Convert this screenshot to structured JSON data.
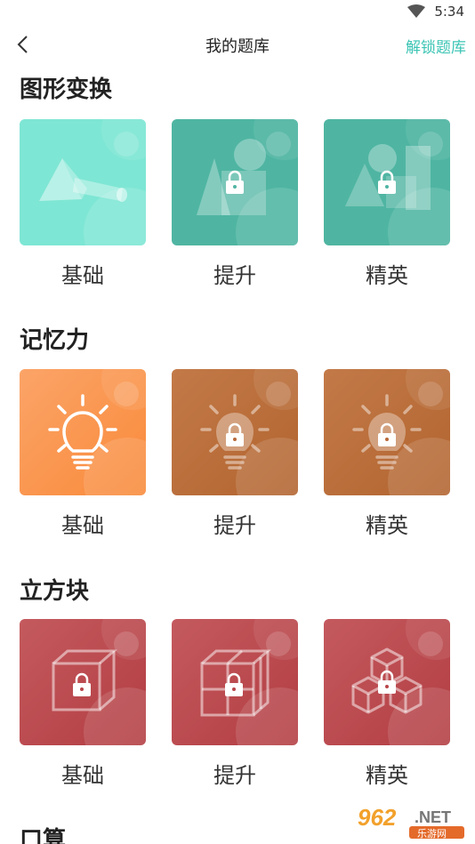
{
  "status": {
    "time": "5:34"
  },
  "nav": {
    "title": "我的题库",
    "action": "解锁题库"
  },
  "sections": [
    {
      "title": "图形变换",
      "items": [
        {
          "label": "基础"
        },
        {
          "label": "提升"
        },
        {
          "label": "精英"
        }
      ]
    },
    {
      "title": "记忆力",
      "items": [
        {
          "label": "基础"
        },
        {
          "label": "提升"
        },
        {
          "label": "精英"
        }
      ]
    },
    {
      "title": "立方块",
      "items": [
        {
          "label": "基础"
        },
        {
          "label": "提升"
        },
        {
          "label": "精英"
        }
      ]
    },
    {
      "title": "口算",
      "items": []
    }
  ],
  "colors": {
    "accent": "#3cc5b4",
    "teal_light": "#7ee6d4",
    "teal_dark": "#4fb5a2",
    "orange": "#f98a3a",
    "brown": "#bb6e3b",
    "red": "#b94a4e"
  },
  "watermark": {
    "number": "962",
    "suffix": ".NET",
    "site": "乐游网"
  }
}
